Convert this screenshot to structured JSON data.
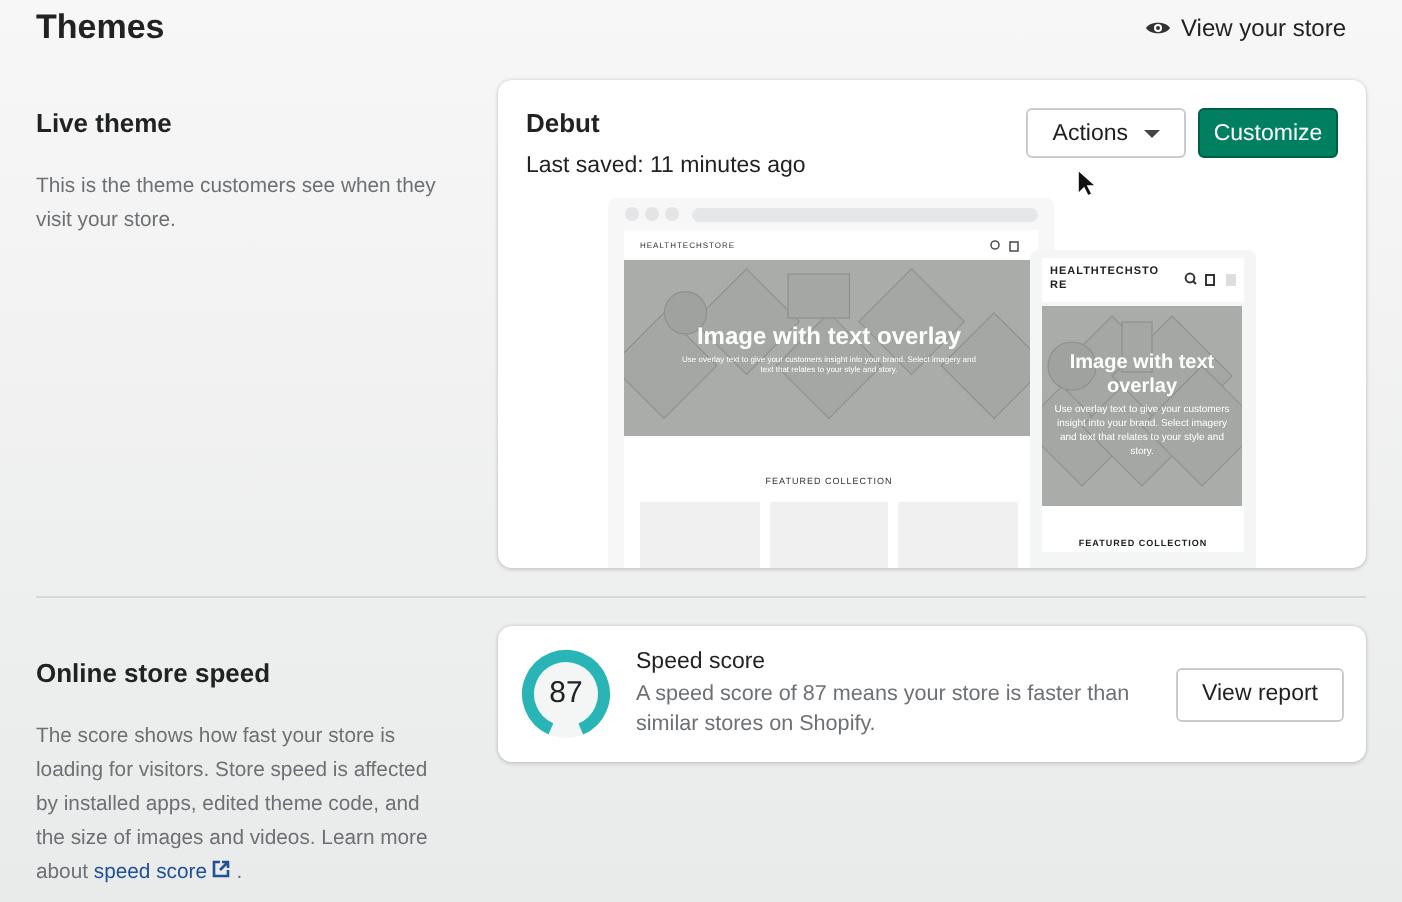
{
  "header": {
    "title": "Themes",
    "view_store": "View your store"
  },
  "live_theme": {
    "heading": "Live theme",
    "description": "This is the theme customers see when they visit your store.",
    "theme_name": "Debut",
    "last_saved": "Last saved: 11 minutes ago",
    "actions_label": "Actions",
    "customize_label": "Customize",
    "preview": {
      "desktop": {
        "store_name": "HEALTHTECHSTORE",
        "hero_title": "Image with text overlay",
        "hero_text": "Use overlay text to give your customers insight into your brand. Select imagery and text that relates to your style and story.",
        "section_title": "FEATURED COLLECTION"
      },
      "mobile": {
        "store_name": "HEALTHTECHSTO RE",
        "hero_title": "Image with text overlay",
        "hero_text": "Use overlay text to give your customers insight into your brand. Select imagery and text that relates to your style and story.",
        "section_title": "FEATURED COLLECTION"
      }
    }
  },
  "speed": {
    "heading": "Online store speed",
    "description": "The score shows how fast your store is loading for visitors. Store speed is affected by installed apps, edited theme code, and the size of images and videos. Learn more about",
    "link": "speed score",
    "link_suffix": ".",
    "score": "87",
    "level": 0.87,
    "card_title": "Speed score",
    "card_text": "A speed score of 87 means your store is faster than similar stores on Shopify.",
    "report_label": "View report"
  }
}
